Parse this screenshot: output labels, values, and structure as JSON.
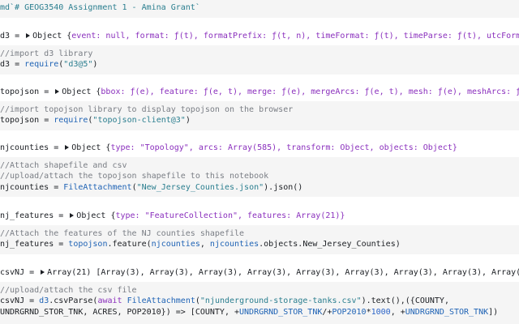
{
  "cells": {
    "c1": {
      "code": "md`# GEOG3540 Assignment 1 - Amina Grant`"
    },
    "c2": {
      "out_var": "d3",
      "out_rest": " = ",
      "out_obj": "Object {",
      "out_props": "event: null, format: ƒ(t), formatPrefix: ƒ(t, n), timeFormat: ƒ(t), timeParse: ƒ(t), utcFormat: ƒ(t",
      "comment": "//import d3 library",
      "code_var": "d3",
      "code_eq": " = ",
      "code_fn": "require",
      "code_arg": "\"d3@5\"",
      "code_close": ")"
    },
    "c3": {
      "out_var": "topojson",
      "out_rest": " = ",
      "out_obj": "Object {",
      "out_props": "bbox: ƒ(e), feature: ƒ(e, t), merge: ƒ(e), mergeArcs: ƒ(e, t), mesh: ƒ(e), meshArcs: ƒ(e, t,",
      "comment": "//import topojson library to display topojson on the browser",
      "code_var": "topojson",
      "code_eq": " = ",
      "code_fn": "require",
      "code_arg": "\"topojson-client@3\"",
      "code_close": ")"
    },
    "c4": {
      "out_var": "njcounties",
      "out_rest": " = ",
      "out_obj": "Object {",
      "out_props": "type: \"Topology\", arcs: Array(585), transform: Object, objects: Object}",
      "comment1": "//Attach shapefile and csv",
      "comment2": "//upload/attach the topojson shapefile to this notebook",
      "code_var": "njcounties",
      "code_eq": " = ",
      "code_fn": "FileAttachment",
      "code_arg": "\"New_Jersey_Counties.json\"",
      "code_close": ").json()"
    },
    "c5": {
      "out_var": "nj_features",
      "out_rest": " = ",
      "out_obj": "Object {",
      "out_props": "type: \"FeatureCollection\", features: Array(21)}",
      "comment": "//Attach the features of the NJ counties shapefile",
      "code_var": "nj_features",
      "code_eq": " = ",
      "code_fn": "topojson",
      "code_mid": ".feature(",
      "code_a1": "njcounties",
      "code_sep": ", ",
      "code_a2": "njcounties",
      "code_close": ".objects.New_Jersey_Counties)"
    },
    "c6": {
      "out_var": "csvNJ",
      "out_rest": " = ",
      "out_obj": "Array(21) [",
      "out_props": "Array(3), Array(3), Array(3), Array(3), Array(3), Array(3), Array(3), Array(3), Array(3), Arr",
      "comment": "//upload/attach the csv file",
      "l1_var": "csvNJ",
      "l1_eq": " = ",
      "l1_d3": "d3",
      "l1_parse": ".csvParse(",
      "l1_await": "await",
      "l1_sp": " ",
      "l1_fa": "FileAttachment",
      "l1_open": "(",
      "l1_file": "\"njunderground-storage-tanks.csv\"",
      "l1_rest": ").text(),({COUNTY,",
      "l2_a": "UNDRGRND_STOR_TNK, ACRES, POP2010}) => [COUNTY, +",
      "l2_b": "UNDRGRND_STOR_TNK",
      "l2_c": "/+",
      "l2_d": "POP2010",
      "l2_e": "*",
      "l2_num": "1000",
      "l2_f": ", +",
      "l2_g": "UNDRGRND_STOR_TNK",
      "l2_h": "])"
    }
  }
}
